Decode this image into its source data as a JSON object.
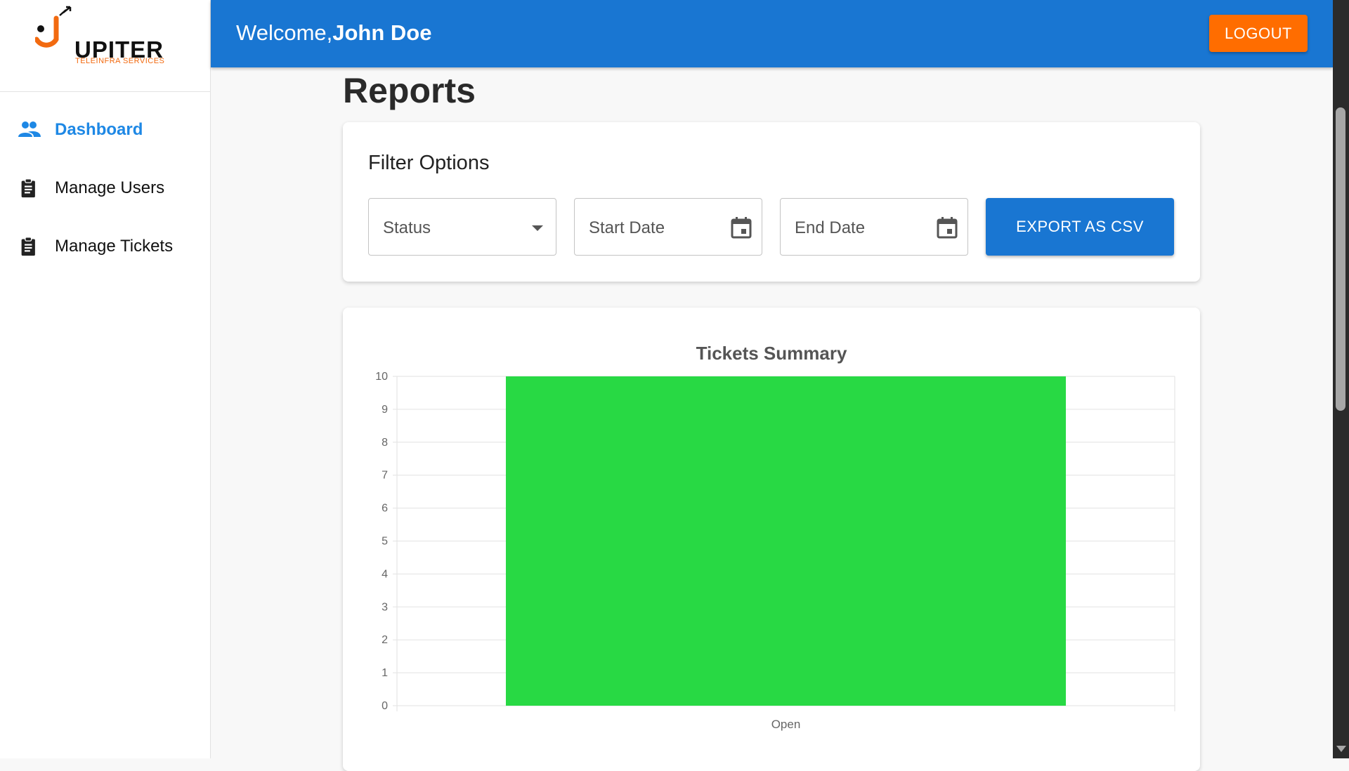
{
  "sidebar": {
    "logo": {
      "text": "UPITER",
      "subtitle": "TELEINFRA SERVICES",
      "brand_color": "#f26a10"
    },
    "items": [
      {
        "label": "Dashboard",
        "icon": "people-icon",
        "active": true
      },
      {
        "label": "Manage Users",
        "icon": "clipboard-icon",
        "active": false
      },
      {
        "label": "Manage Tickets",
        "icon": "clipboard-icon",
        "active": false
      }
    ]
  },
  "header": {
    "welcome_prefix": "Welcome,",
    "user_name": "John Doe",
    "logout_label": "LOGOUT",
    "bar_color": "#1976d2",
    "logout_color": "#ff6d00"
  },
  "main": {
    "title": "Reports",
    "filter": {
      "title": "Filter Options",
      "status_placeholder": "Status",
      "start_date_placeholder": "Start Date",
      "end_date_placeholder": "End Date",
      "export_label": "EXPORT AS CSV"
    }
  },
  "chart_data": {
    "type": "bar",
    "title": "Tickets Summary",
    "categories": [
      "Open"
    ],
    "values": [
      10
    ],
    "ylim": [
      0,
      10
    ],
    "yticks": [
      0,
      1,
      2,
      3,
      4,
      5,
      6,
      7,
      8,
      9,
      10
    ],
    "xlabel": "",
    "ylabel": "",
    "grid": true,
    "bar_color": "#28d944"
  }
}
